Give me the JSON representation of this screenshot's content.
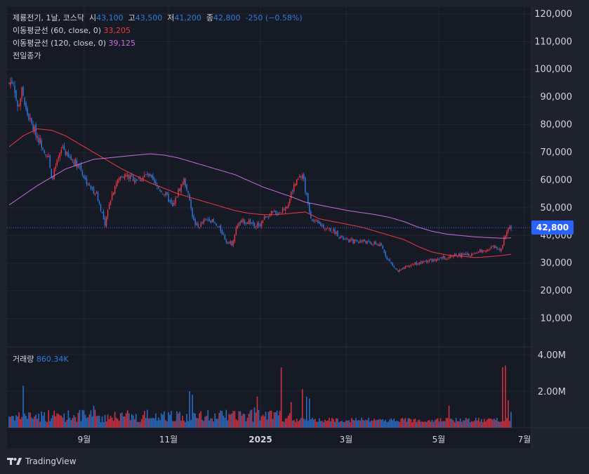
{
  "legend": {
    "symbol": "제룡전기, 1날, 코스닥",
    "open_label": "시",
    "open": "43,100",
    "high_label": "고",
    "high": "43,500",
    "low_label": "저",
    "low": "41,200",
    "close_label": "종",
    "close": "42,800",
    "change": "-250 (−0.58%)",
    "ma60_label": "이동평균선 (60, close, 0)",
    "ma60_value": "33,205",
    "ma120_label": "이동평균선 (120, close, 0)",
    "ma120_value": "39,125",
    "prev_close_label": "전일종가"
  },
  "volume_legend": {
    "label": "거래량",
    "value": "860.34K"
  },
  "last_price_tag": "42,800",
  "branding": "TradingView",
  "colors": {
    "up": "#f23645",
    "down": "#2e7be0",
    "ma60": "#f23645",
    "ma120": "#c46ddb",
    "tag": "#2962ff",
    "background": "#161a24"
  },
  "chart_data": {
    "type": "candlestick",
    "price_axis": {
      "ticks": [
        10000,
        20000,
        30000,
        40000,
        50000,
        60000,
        70000,
        80000,
        90000,
        100000,
        110000,
        120000
      ],
      "tick_labels": [
        "10,000",
        "20,000",
        "30,000",
        "40,000",
        "50,000",
        "60,000",
        "70,000",
        "80,000",
        "90,000",
        "100,000",
        "110,000",
        "120,000"
      ],
      "range": [
        0,
        122500
      ]
    },
    "volume_axis": {
      "tick_labels": [
        "2.00M",
        "4.00M"
      ],
      "ticks": [
        2000000,
        4000000
      ],
      "range": [
        0,
        4000000
      ]
    },
    "time_axis": {
      "labels": [
        "9월",
        "11월",
        "2025",
        "3월",
        "5월",
        "7월"
      ]
    },
    "price_path": [
      [
        0,
        95000
      ],
      [
        3,
        96000
      ],
      [
        6,
        86000
      ],
      [
        9,
        92000
      ],
      [
        12,
        85000
      ],
      [
        16,
        80000
      ],
      [
        20,
        76000
      ],
      [
        24,
        72000
      ],
      [
        28,
        68000
      ],
      [
        30,
        60000
      ],
      [
        34,
        66000
      ],
      [
        38,
        72000
      ],
      [
        42,
        68000
      ],
      [
        46,
        67000
      ],
      [
        50,
        65000
      ],
      [
        54,
        60000
      ],
      [
        58,
        57000
      ],
      [
        62,
        55000
      ],
      [
        66,
        48000
      ],
      [
        68,
        43000
      ],
      [
        71,
        52000
      ],
      [
        75,
        58000
      ],
      [
        80,
        62000
      ],
      [
        86,
        61000
      ],
      [
        92,
        60000
      ],
      [
        98,
        62000
      ],
      [
        104,
        58000
      ],
      [
        108,
        56000
      ],
      [
        112,
        54000
      ],
      [
        116,
        50000
      ],
      [
        120,
        56000
      ],
      [
        124,
        60000
      ],
      [
        126,
        57000
      ],
      [
        128,
        52000
      ],
      [
        131,
        45000
      ],
      [
        134,
        43000
      ],
      [
        138,
        45000
      ],
      [
        142,
        46000
      ],
      [
        146,
        44000
      ],
      [
        150,
        42000
      ],
      [
        154,
        38000
      ],
      [
        158,
        37000
      ],
      [
        162,
        44000
      ],
      [
        166,
        45000
      ],
      [
        170,
        45000
      ],
      [
        174,
        44000
      ],
      [
        178,
        44000
      ],
      [
        182,
        47000
      ],
      [
        186,
        48000
      ],
      [
        190,
        48000
      ],
      [
        194,
        49000
      ],
      [
        198,
        52000
      ],
      [
        202,
        58000
      ],
      [
        205,
        60000
      ],
      [
        208,
        62000
      ],
      [
        211,
        54000
      ],
      [
        213,
        48000
      ],
      [
        216,
        45000
      ],
      [
        220,
        44000
      ],
      [
        224,
        43000
      ],
      [
        228,
        42000
      ],
      [
        232,
        41000
      ],
      [
        236,
        39000
      ],
      [
        240,
        38000
      ],
      [
        244,
        38000
      ],
      [
        248,
        38000
      ],
      [
        252,
        38000
      ],
      [
        256,
        37000
      ],
      [
        260,
        37000
      ],
      [
        264,
        36000
      ],
      [
        268,
        32000
      ],
      [
        272,
        29000
      ],
      [
        276,
        27000
      ],
      [
        280,
        28000
      ],
      [
        284,
        29000
      ],
      [
        288,
        30000
      ],
      [
        292,
        30000
      ],
      [
        296,
        31000
      ],
      [
        300,
        31000
      ],
      [
        304,
        31000
      ],
      [
        308,
        32000
      ],
      [
        312,
        32000
      ],
      [
        316,
        33000
      ],
      [
        320,
        33000
      ],
      [
        324,
        33000
      ],
      [
        328,
        33000
      ],
      [
        332,
        34000
      ],
      [
        336,
        35000
      ],
      [
        340,
        35000
      ],
      [
        344,
        36000
      ],
      [
        348,
        35000
      ],
      [
        350,
        37000
      ],
      [
        352,
        40000
      ],
      [
        354,
        43000
      ],
      [
        356,
        42800
      ]
    ],
    "ma60_path": [
      [
        0,
        72000
      ],
      [
        10,
        76000
      ],
      [
        20,
        78500
      ],
      [
        30,
        78000
      ],
      [
        40,
        76000
      ],
      [
        50,
        73000
      ],
      [
        60,
        70000
      ],
      [
        70,
        67000
      ],
      [
        80,
        64000
      ],
      [
        90,
        61500
      ],
      [
        100,
        59000
      ],
      [
        110,
        57000
      ],
      [
        120,
        55000
      ],
      [
        130,
        53500
      ],
      [
        140,
        52000
      ],
      [
        150,
        50500
      ],
      [
        160,
        49000
      ],
      [
        170,
        48000
      ],
      [
        180,
        47500
      ],
      [
        190,
        47500
      ],
      [
        200,
        48000
      ],
      [
        210,
        48500
      ],
      [
        220,
        46000
      ],
      [
        230,
        45000
      ],
      [
        240,
        44000
      ],
      [
        250,
        43000
      ],
      [
        260,
        41500
      ],
      [
        270,
        40000
      ],
      [
        280,
        38500
      ],
      [
        290,
        36000
      ],
      [
        300,
        34000
      ],
      [
        310,
        33000
      ],
      [
        320,
        32500
      ],
      [
        330,
        32000
      ],
      [
        340,
        32300
      ],
      [
        350,
        32800
      ],
      [
        356,
        33205
      ]
    ],
    "ma120_path": [
      [
        0,
        51000
      ],
      [
        20,
        58000
      ],
      [
        40,
        64000
      ],
      [
        60,
        67500
      ],
      [
        80,
        68500
      ],
      [
        100,
        69500
      ],
      [
        110,
        69000
      ],
      [
        120,
        68000
      ],
      [
        140,
        65000
      ],
      [
        160,
        62000
      ],
      [
        180,
        57500
      ],
      [
        200,
        54000
      ],
      [
        210,
        52000
      ],
      [
        220,
        51000
      ],
      [
        240,
        49000
      ],
      [
        260,
        47500
      ],
      [
        270,
        46500
      ],
      [
        280,
        45000
      ],
      [
        290,
        43000
      ],
      [
        300,
        41500
      ],
      [
        310,
        40500
      ],
      [
        320,
        40000
      ],
      [
        330,
        39500
      ],
      [
        340,
        39200
      ],
      [
        350,
        39000
      ],
      [
        356,
        39125
      ]
    ],
    "volume_spikes": [
      [
        10,
        2300000
      ],
      [
        60,
        1200000
      ],
      [
        128,
        2000000
      ],
      [
        130,
        1800000
      ],
      [
        174,
        1100000
      ],
      [
        176,
        1700000
      ],
      [
        193,
        3300000
      ],
      [
        200,
        1400000
      ],
      [
        208,
        2100000
      ],
      [
        211,
        1700000
      ],
      [
        213,
        1600000
      ],
      [
        312,
        1200000
      ],
      [
        350,
        3300000
      ],
      [
        352,
        3400000
      ],
      [
        354,
        1500000
      ],
      [
        356,
        860000
      ]
    ]
  }
}
